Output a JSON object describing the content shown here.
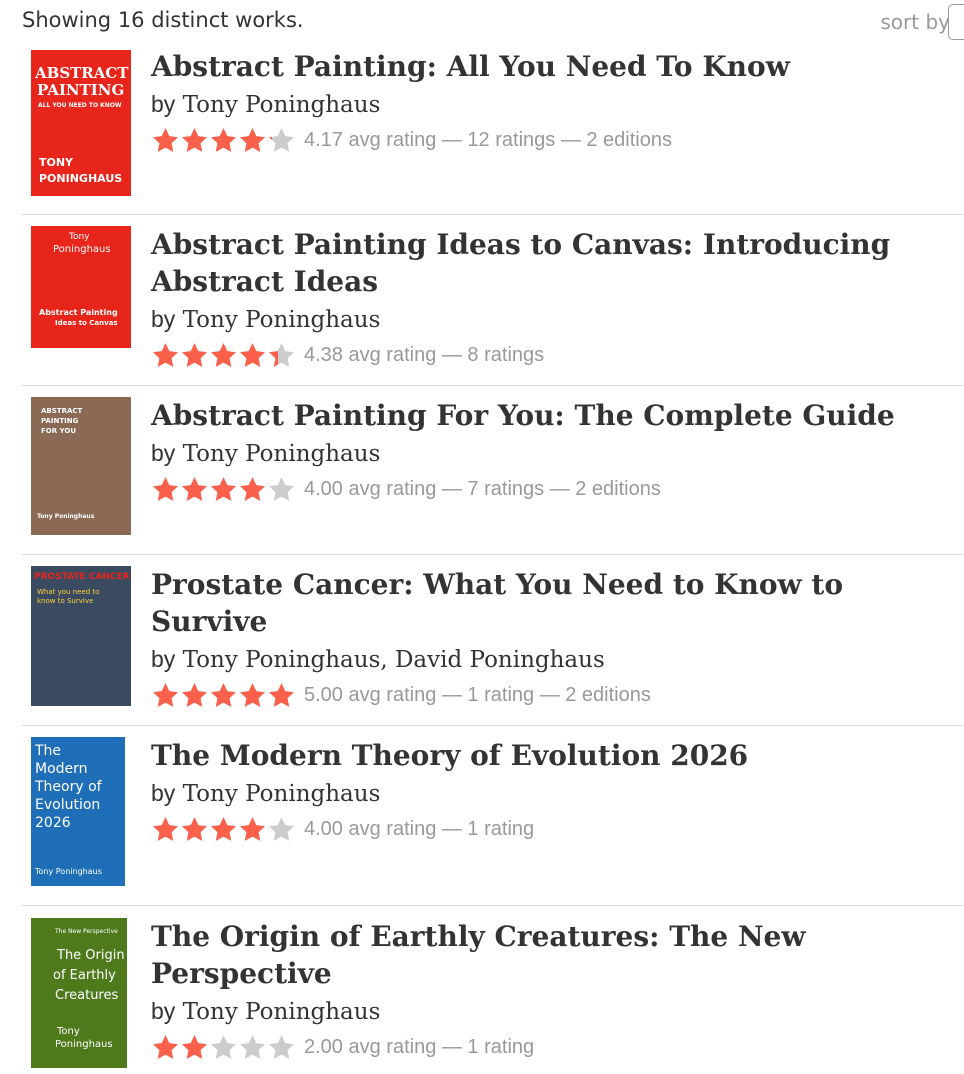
{
  "header": {
    "showing": "Showing 16 distinct works.",
    "sort_label": "sort by"
  },
  "colors": {
    "star_filled": "#fa604a",
    "star_empty": "#ccc",
    "meta_text": "#999"
  },
  "books": [
    {
      "title": "Abstract Painting: All You Need To Know",
      "by": "by",
      "author": "Tony Poninghaus",
      "rating_value": 4.17,
      "rating_text": "4.17 avg rating — 12 ratings — 2 editions",
      "cover": {
        "lines": [
          "ABSTRACT",
          "PAINTING",
          "ALL YOU NEED TO KNOW",
          "TONY",
          "PONINGHAUS"
        ],
        "bg": "#e8251b",
        "fg": "#ffffff"
      }
    },
    {
      "title": "Abstract Painting Ideas to Canvas: Introducing Abstract Ideas",
      "by": "by",
      "author": "Tony Poninghaus",
      "rating_value": 4.38,
      "rating_text": "4.38 avg rating — 8 ratings",
      "cover": {
        "lines": [
          "Tony",
          "Poninghaus",
          "Abstract Painting",
          "Ideas to Canvas"
        ],
        "bg": "#e8251b",
        "fg": "#ffffff"
      }
    },
    {
      "title": "Abstract Painting For You: The Complete Guide",
      "by": "by",
      "author": "Tony Poninghaus",
      "rating_value": 4.0,
      "rating_text": "4.00 avg rating — 7 ratings — 2 editions",
      "cover": {
        "lines": [
          "ABSTRACT",
          "PAINTING",
          "FOR YOU",
          "Tony Poninghaus"
        ],
        "bg": "#8a6a55",
        "fg": "#ffffff"
      }
    },
    {
      "title": "Prostate Cancer: What You Need to Know to Survive",
      "by": "by",
      "author": "Tony Poninghaus, David Poninghaus",
      "rating_value": 5.0,
      "rating_text": "5.00 avg rating — 1 rating — 2 editions",
      "cover": {
        "lines": [
          "PROSTATE CANCER",
          "What you need to",
          "know to Survive"
        ],
        "bg": "#3a4a60",
        "fg": "#ffd23a"
      }
    },
    {
      "title": "The Modern Theory of Evolution 2026",
      "by": "by",
      "author": "Tony Poninghaus",
      "rating_value": 4.0,
      "rating_text": "4.00 avg rating — 1 rating",
      "cover": {
        "lines": [
          "The",
          "Modern",
          "Theory of",
          "Evolution",
          "2026",
          "Tony Poninghaus"
        ],
        "bg": "#1f6fb8",
        "fg": "#ffffff"
      }
    },
    {
      "title": "The Origin of Earthly Creatures: The New Perspective",
      "by": "by",
      "author": "Tony Poninghaus",
      "rating_value": 2.0,
      "rating_text": "2.00 avg rating — 1 rating",
      "cover": {
        "lines": [
          "The New Perspective",
          "The Origin",
          "of Earthly",
          "Creatures",
          "Tony",
          "Poninghaus"
        ],
        "bg": "#4e7a1c",
        "fg": "#ffffff"
      }
    }
  ]
}
